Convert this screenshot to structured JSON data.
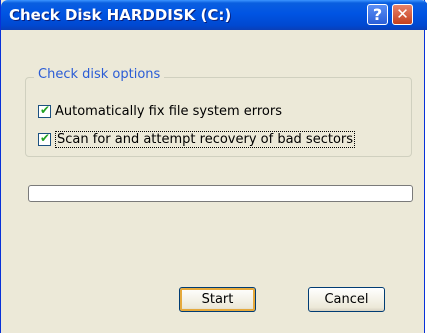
{
  "window": {
    "title": "Check Disk HARDDISK (C:)",
    "help_glyph": "?",
    "close_glyph": "✕"
  },
  "options": {
    "group_label": "Check disk options",
    "items": [
      {
        "label": "Automatically fix file system errors",
        "checked": true
      },
      {
        "label": "Scan for and attempt recovery of bad sectors",
        "checked": true
      }
    ]
  },
  "progress": {
    "value": 0
  },
  "buttons": {
    "start_label": "Start",
    "cancel_label": "Cancel"
  },
  "colors": {
    "title_bar": "#0054e3",
    "group_label": "#2a5cd6",
    "check_mark": "#21a121",
    "default_button_outline": "#e5a93c"
  }
}
